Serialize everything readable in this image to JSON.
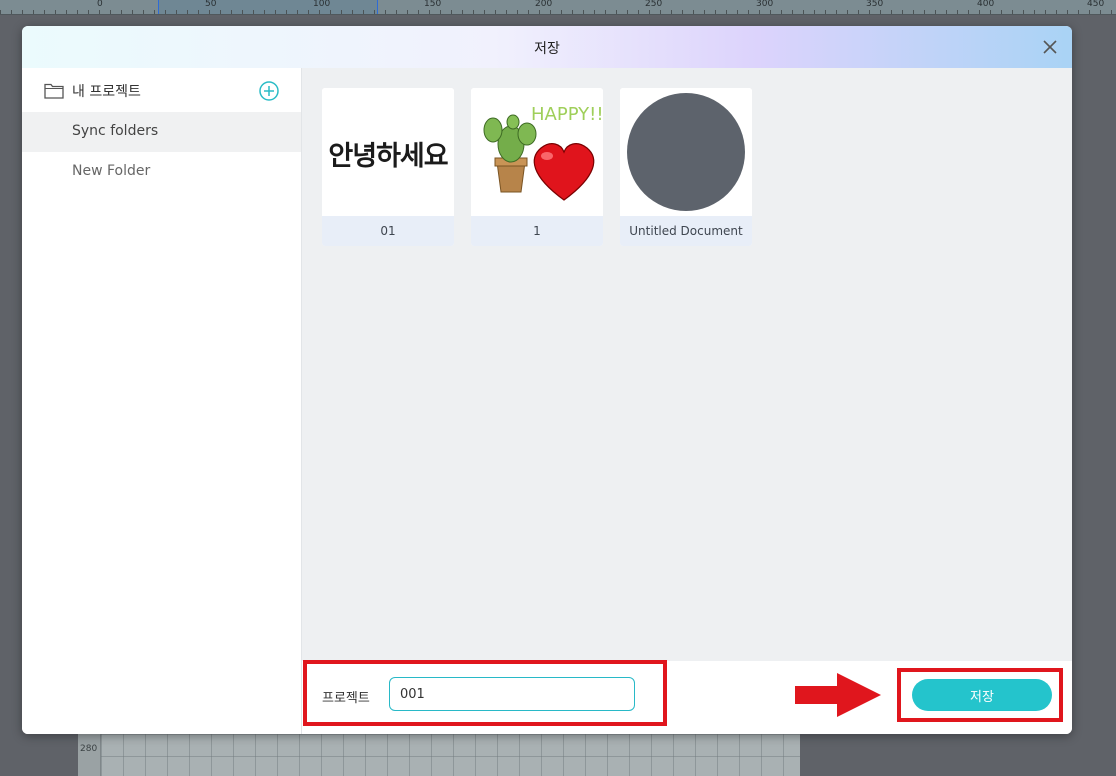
{
  "ruler": {
    "labels": [
      "0",
      "50",
      "100",
      "150",
      "200",
      "250",
      "300",
      "350",
      "400",
      "450"
    ]
  },
  "canvas": {
    "vertical_ruler_label": "280"
  },
  "dialog": {
    "title": "저장",
    "sidebar": {
      "header_label": "내 프로젝트",
      "items": [
        {
          "label": "Sync folders",
          "active": true
        },
        {
          "label": "New Folder",
          "active": false
        }
      ]
    },
    "projects": [
      {
        "label": "01",
        "thumb_text": "안녕하세요"
      },
      {
        "label": "1",
        "thumb_text": "HAPPY!!"
      },
      {
        "label": "Untitled Document"
      }
    ],
    "footer": {
      "name_label": "프로젝트",
      "name_value": "001",
      "save_label": "저장"
    }
  },
  "colors": {
    "accent": "#24c4cc",
    "highlight": "#e0161d",
    "circle": "#5d636c"
  }
}
